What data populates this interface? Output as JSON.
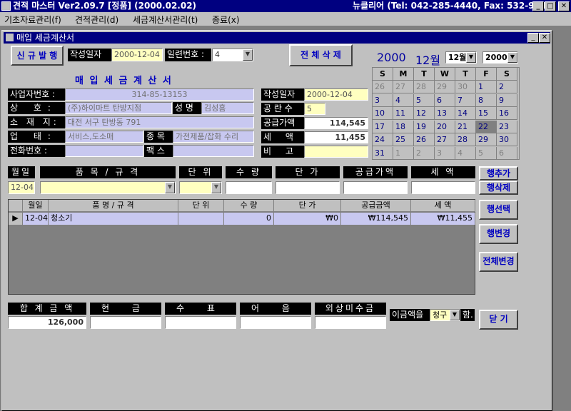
{
  "window": {
    "title": "견적 마스터 Ver2.09.7 [정품] (2000.02.02)",
    "company": "뉴클리어 (Tel: 042-285-4440, Fax: 532-9144)",
    "min": "_",
    "max": "□",
    "close": "✕"
  },
  "menu": [
    "기초자료관리(f)",
    "견적관리(d)",
    "세금계산서관리(t)",
    "종료(x)"
  ],
  "child": {
    "title": "매입 세금계산서"
  },
  "top": {
    "new_button": "신 규 발 행",
    "date_label": "작성일자",
    "date_value": "2000-12-04",
    "serial_label": "일련번호 :",
    "serial_value": "4",
    "delete_all": "전 체 삭 제",
    "heading": "매 입 세 금 계 산 서"
  },
  "supplier": {
    "biz_no_label": "사업자번호 :",
    "biz_no": "314-85-13153",
    "name_label": "상 호:",
    "name": "(주)하이마트 탄방지점",
    "owner_label": "성 명",
    "owner": "김성흠",
    "addr_label": "소 재 지:",
    "addr": "대전 서구 탄방동 791",
    "type_label": "업 태:",
    "type": "서비스,도소매",
    "item_label": "종 목",
    "item": "가전제품/잡화 수리",
    "tel_label": "전화번호 :",
    "tel": "",
    "fax_label": "팩 스",
    "fax": ""
  },
  "summary": {
    "date_label": "작성일자",
    "date": "2000-12-04",
    "blank_label": "공 란 수",
    "blank": "5",
    "supply_label": "공급가액",
    "supply": "114,545",
    "tax_label": "세 액",
    "tax": "11,455",
    "note_label": "비 고",
    "note": ""
  },
  "calendar": {
    "year": "2000",
    "month": "12월",
    "month_select": "12월",
    "year_select": "2000",
    "days": [
      "S",
      "M",
      "T",
      "W",
      "T",
      "F",
      "S"
    ],
    "weeks": [
      [
        "26",
        "27",
        "28",
        "29",
        "30",
        "1",
        "2"
      ],
      [
        "3",
        "4",
        "5",
        "6",
        "7",
        "8",
        "9"
      ],
      [
        "10",
        "11",
        "12",
        "13",
        "14",
        "15",
        "16"
      ],
      [
        "17",
        "18",
        "19",
        "20",
        "21",
        "22",
        "23"
      ],
      [
        "24",
        "25",
        "26",
        "27",
        "28",
        "29",
        "30"
      ],
      [
        "31",
        "1",
        "2",
        "3",
        "4",
        "5",
        "6"
      ]
    ],
    "selected": "22"
  },
  "entry": {
    "headers": [
      "월일",
      "품 목 / 규 격",
      "단 위",
      "수 량",
      "단 가",
      "공급가액",
      "세 액"
    ],
    "date": "12-04"
  },
  "table": {
    "headers": [
      "월일",
      "품 명 / 규 격",
      "단 위",
      "수 량",
      "단 가",
      "공급금액",
      "세 액"
    ],
    "rows": [
      [
        "12-04",
        "청소기",
        "",
        "0",
        "₩0",
        "₩114,545",
        "₩11,455"
      ]
    ]
  },
  "side": {
    "add_row": "행추가",
    "del_row": "행삭제",
    "select_row": "행선택",
    "change_row": "행변경",
    "change_all": "전체변경",
    "close": "닫 기"
  },
  "totals": {
    "headers": [
      "합 계 금 액",
      "현 금",
      "수 표",
      "어 음",
      "외상미수금"
    ],
    "values": [
      "126,000",
      "",
      "",
      "",
      ""
    ],
    "label": "이금액을",
    "mode": "청구",
    "suffix": "함."
  }
}
